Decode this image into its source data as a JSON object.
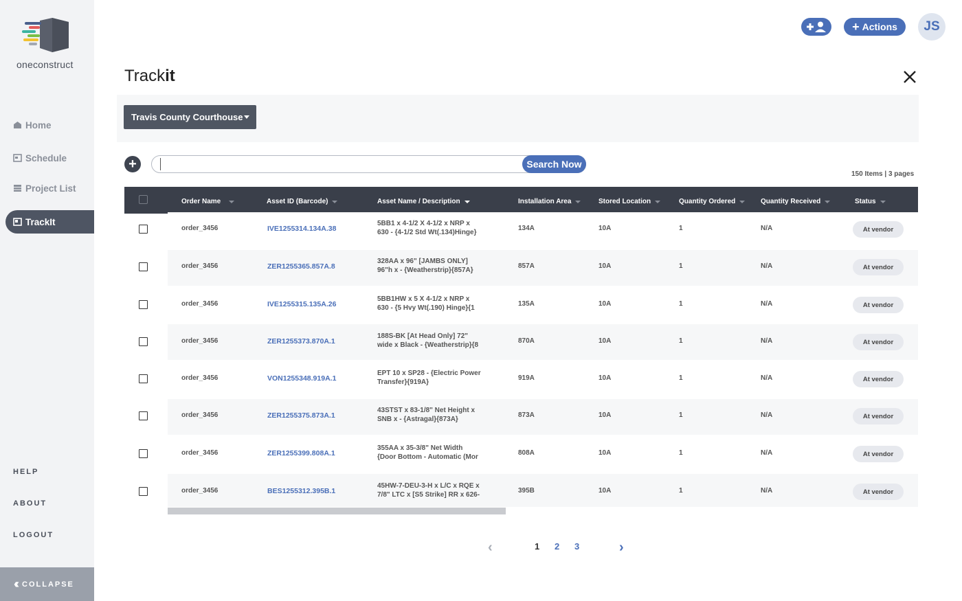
{
  "brand": {
    "name": "oneconstruct"
  },
  "sidebar": {
    "nav": [
      {
        "label": "Home",
        "icon": "home-icon"
      },
      {
        "label": "Schedule",
        "icon": "calendar-icon"
      },
      {
        "label": "Project List",
        "icon": "list-icon"
      },
      {
        "label": "TrackIt",
        "icon": "trackit-icon",
        "active": true
      }
    ],
    "links": [
      "HELP",
      "ABOUT",
      "LOGOUT"
    ],
    "collapse_label": "COLLAPSE"
  },
  "topbar": {
    "actions_label": "Actions",
    "avatar_initials": "JS"
  },
  "page": {
    "title_regular": "Track",
    "title_bold": "it",
    "project": "Travis County Courthouse",
    "search_button": "Search Now",
    "search_value": "",
    "item_count": "150 Items |  3 pages"
  },
  "table": {
    "columns": [
      "Order Name",
      "Asset ID (Barcode)",
      "Asset Name / Description",
      "Installation Area",
      "Stored Location",
      "Quantity Ordered",
      "Quantity Received",
      "Status"
    ],
    "rows": [
      {
        "order": "order_3456",
        "asset_id": "IVE1255314.134A.38",
        "desc1": "5BB1 x 4-1/2 X 4-1/2 x NRP x",
        "desc2": "630 - {4-1/2 Std Wt(.134)Hinge}",
        "area": "134A",
        "stored": "10A",
        "qty_ordered": "1",
        "qty_received": "N/A",
        "status": "At vendor"
      },
      {
        "order": "order_3456",
        "asset_id": "ZER1255365.857A.8",
        "desc1": "328AA x 96\" [JAMBS ONLY]",
        "desc2": "96\"h x  - {Weatherstrip}{857A}",
        "area": "857A",
        "stored": "10A",
        "qty_ordered": "1",
        "qty_received": "N/A",
        "status": "At vendor"
      },
      {
        "order": "order_3456",
        "asset_id": "IVE1255315.135A.26",
        "desc1": "5BB1HW x 5 X 4-1/2 x NRP x",
        "desc2": "630 - {5 Hvy Wt(.190) Hinge}{1",
        "area": "135A",
        "stored": "10A",
        "qty_ordered": "1",
        "qty_received": "N/A",
        "status": "At vendor"
      },
      {
        "order": "order_3456",
        "asset_id": "ZER1255373.870A.1",
        "desc1": "188S-BK [At Head Only] 72\"",
        "desc2": "wide x Black - {Weatherstrip}{8",
        "area": "870A",
        "stored": "10A",
        "qty_ordered": "1",
        "qty_received": "N/A",
        "status": "At vendor"
      },
      {
        "order": "order_3456",
        "asset_id": "VON1255348.919A.1",
        "desc1": "EPT 10 x SP28 - {Electric Power",
        "desc2": "Transfer}{919A}",
        "area": "919A",
        "stored": "10A",
        "qty_ordered": "1",
        "qty_received": "N/A",
        "status": "At vendor"
      },
      {
        "order": "order_3456",
        "asset_id": "ZER1255375.873A.1",
        "desc1": "43STST x 83-1/8\" Net Height x",
        "desc2": "SNB x  - {Astragal}{873A}",
        "area": "873A",
        "stored": "10A",
        "qty_ordered": "1",
        "qty_received": "N/A",
        "status": "At vendor"
      },
      {
        "order": "order_3456",
        "asset_id": "ZER1255399.808A.1",
        "desc1": "355AA x 35-3/8\" Net Width",
        "desc2": "{Door Bottom - Automatic (Mor",
        "area": "808A",
        "stored": "10A",
        "qty_ordered": "1",
        "qty_received": "N/A",
        "status": "At vendor"
      },
      {
        "order": "order_3456",
        "asset_id": "BES1255312.395B.1",
        "desc1": "45HW-7-DEU-3-H x L/C x RQE x",
        "desc2": "7/8\" LTC x [S5 Strike] RR x 626-",
        "area": "395B",
        "stored": "10A",
        "qty_ordered": "1",
        "qty_received": "N/A",
        "status": "At vendor"
      }
    ]
  },
  "pagination": {
    "pages": [
      "1",
      "2",
      "3"
    ],
    "current": "1"
  },
  "colors": {
    "accent": "#4a6fb8",
    "header": "#3a3f4a",
    "sidebar_active": "#4e5563"
  }
}
